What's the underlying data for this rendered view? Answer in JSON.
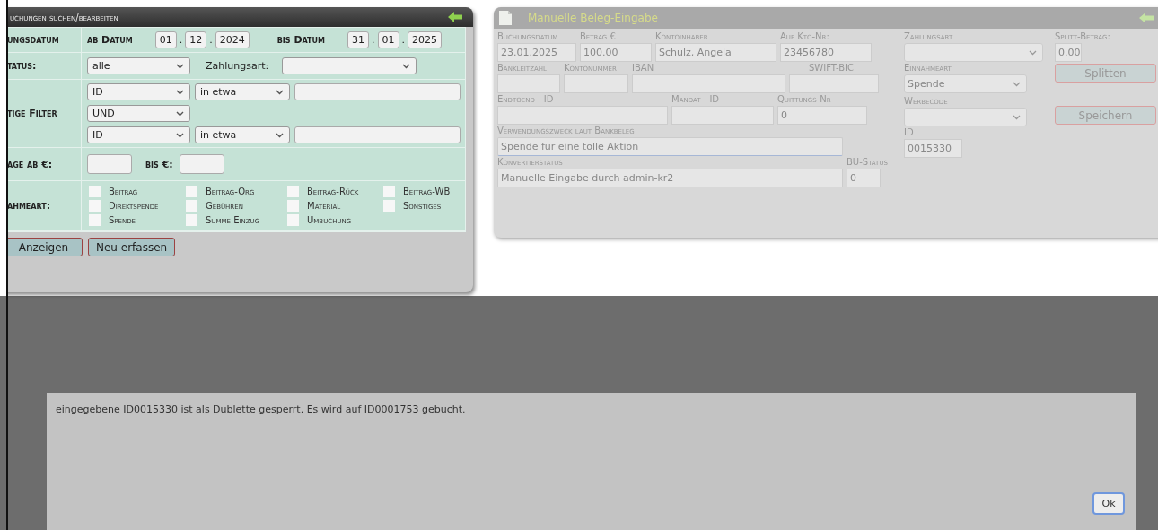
{
  "search_panel": {
    "title": "uchungen suchen/bearbeiten",
    "date_row": {
      "label": "ungsdatum",
      "from_label": "ab Datum",
      "from": [
        "01",
        "12",
        "2024"
      ],
      "to_label": "bis Datum",
      "to": [
        "31",
        "01",
        "2025"
      ],
      "separator": "."
    },
    "status_row": {
      "label": "tatus:",
      "status": "alle",
      "payment_label": "Zahlungsart:"
    },
    "filter_row": {
      "label": "tige Filter",
      "join": "UND",
      "filters": [
        {
          "field": "ID",
          "operator": "in etwa"
        },
        {
          "field": "ID",
          "operator": "in etwa"
        }
      ]
    },
    "amount_row": {
      "label": "äge ab €:",
      "to_label": "bis €:"
    },
    "type_row": {
      "label": "ahmeart:",
      "options": [
        {
          "label": "Beitrag",
          "checked": false
        },
        {
          "label": "Beitrag-Org",
          "checked": false
        },
        {
          "label": "Beitrag-Rück",
          "checked": false
        },
        {
          "label": "Beitrag-WB",
          "checked": false
        },
        {
          "label": "Direktspende",
          "checked": false
        },
        {
          "label": "Gebühren",
          "checked": false
        },
        {
          "label": "Material",
          "checked": false
        },
        {
          "label": "Sonstiges",
          "checked": false
        },
        {
          "label": "Spende",
          "checked": false
        },
        {
          "label": "Summe Einzug",
          "checked": false
        },
        {
          "label": "Umbuchung",
          "checked": false
        }
      ]
    },
    "buttons": [
      "Anzeigen",
      "Neu erfassen"
    ]
  },
  "entry_panel": {
    "title": "Manuelle Beleg-Eingabe",
    "rows": [
      {
        "fields": [
          {
            "label": "Buchungsdatum",
            "value": "23.01.2025",
            "kind": "text"
          },
          {
            "label": "Betrag €",
            "value": "100.00",
            "kind": "text"
          },
          {
            "label": "Kontoinhaber",
            "value": "Schulz, Angela",
            "kind": "text"
          },
          {
            "label": "Auf Kto-Nr:",
            "value": "23456780",
            "kind": "text"
          }
        ]
      },
      {
        "fields": [
          {
            "label": "Bankleitzahl",
            "kind": "text"
          },
          {
            "label": "Kontonummer",
            "kind": "text"
          },
          {
            "label": "IBAN",
            "kind": "text"
          },
          {
            "label": "SWIFT-BIC",
            "kind": "text"
          }
        ]
      },
      {
        "fields": [
          {
            "label": "Endtoend - ID",
            "kind": "text"
          },
          {
            "label": "Mandat - ID",
            "kind": "text"
          },
          {
            "label": "Quittungs-Nr",
            "value": "0",
            "kind": "text"
          }
        ]
      },
      {
        "fields": [
          {
            "label": "Verwendungszweck laut Bankbeleg",
            "value": "Spende für eine tolle Aktion",
            "kind": "textarea"
          }
        ]
      },
      {
        "fields": [
          {
            "label": "Konvertierstatus",
            "value": "Manuelle Eingabe durch admin-kr2",
            "kind": "text"
          },
          {
            "label": "BU-Status",
            "value": "0",
            "kind": "text"
          }
        ]
      }
    ],
    "side_fields": [
      {
        "label": "Zahlungsart",
        "kind": "select"
      },
      {
        "label": "Einnahmeart",
        "value": "Spende",
        "kind": "select"
      },
      {
        "label": "Werbecode",
        "kind": "select"
      },
      {
        "label": "ID",
        "value": "0015330",
        "kind": "text"
      }
    ],
    "split": {
      "label": "Splitt-Betrag:",
      "value": "0.00"
    },
    "buttons": [
      "Splitten",
      "Speichern"
    ]
  },
  "dialog": {
    "message": "eingegebene ID0015330 ist als Dublette gesperrt. Es wird auf ID0001753 gebucht.",
    "button": "Ok"
  }
}
